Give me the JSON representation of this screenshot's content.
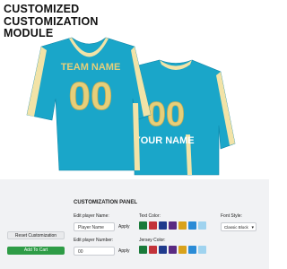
{
  "header": {
    "title_lines": [
      "CUSTOMIZED",
      "CUSTOMIZATION",
      "MODULE"
    ]
  },
  "jersey": {
    "front_team_name": "TEAM NAME",
    "front_number": "00",
    "back_number": "00",
    "back_player_name": "YOUR NAME",
    "colors": {
      "body": "#1aa6c9",
      "trim": "#f2e3a7",
      "text_gold": "#e6cf7a"
    }
  },
  "panel": {
    "title": "CUSTOMIZATION PANEL",
    "reset_button": "Reset Customization",
    "cart_button": "Add To Cart",
    "player_name_label": "Edit player Name:",
    "player_name_value": "Player Name",
    "player_number_label": "Edit player Number:",
    "player_number_value": "00",
    "apply_label_1": "Apply",
    "apply_label_2": "Apply",
    "text_color_label": "Text Color:",
    "jersey_color_label": "Jersey Color:",
    "font_style_label": "Font Style:",
    "font_style_value": "Classic Block",
    "text_colors": [
      "#1a7a3a",
      "#c3333a",
      "#1f3a8c",
      "#5a2a82",
      "#d9a21b",
      "#2a8bd6",
      "#9fd3ef"
    ],
    "jersey_colors": [
      "#1a7a3a",
      "#c3333a",
      "#1f3a8c",
      "#5a2a82",
      "#d9a21b",
      "#2a8bd6",
      "#9fd3ef"
    ]
  }
}
